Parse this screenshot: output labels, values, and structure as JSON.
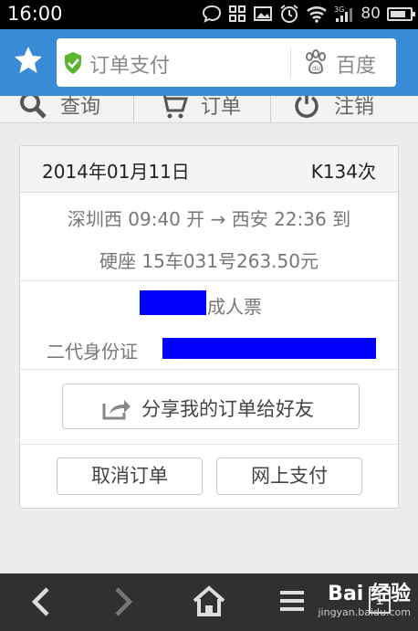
{
  "status_bar": {
    "time": "16:00",
    "battery": "80"
  },
  "browser": {
    "page_title": "订单支付",
    "search_engine": "百度"
  },
  "nav": {
    "query": "查询",
    "orders": "订单",
    "logout": "注销"
  },
  "order": {
    "date": "2014年01月11日",
    "train": "K134次",
    "route": "深圳西 09:40 开 → 西安 22:36 到",
    "seat": "硬座 15车031号263.50元",
    "ticket_type": "成人票",
    "id_type": "二代身份证",
    "share_label": "分享我的订单给好友",
    "cancel_label": "取消订单",
    "pay_label": "网上支付"
  },
  "toolbar": {
    "tab_count": "1"
  },
  "watermark": {
    "main": "Bai 经验",
    "sub": "jingyan.baidu.com"
  },
  "colors": {
    "header_blue": "#3a8bd6",
    "redaction": "#0000ff",
    "toolbar_bg": "#303030"
  }
}
